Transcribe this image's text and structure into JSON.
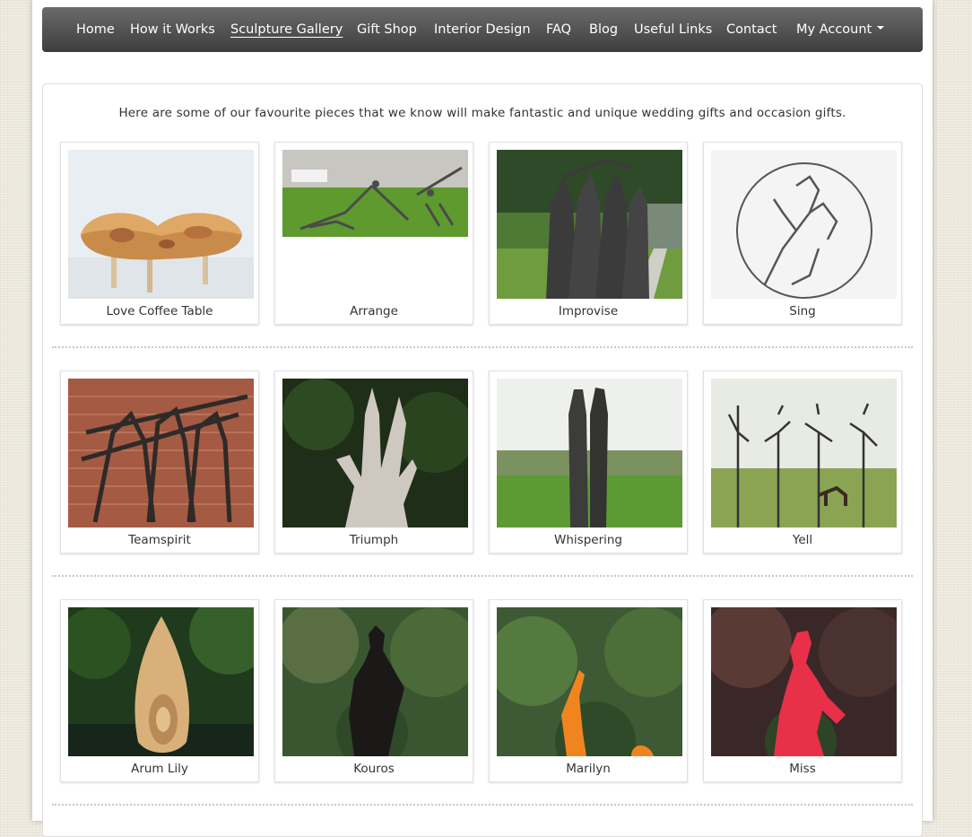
{
  "nav": {
    "items": [
      "Home",
      "How it Works",
      "Sculpture Gallery",
      "Gift Shop",
      "Interior Design",
      "FAQ",
      "Blog",
      "Useful Links",
      "Contact"
    ],
    "account": "My Account"
  },
  "intro": "Here are some of our favourite pieces that we know will make fantastic and unique wedding gifts and occasion gifts.",
  "rows": [
    [
      "Love Coffee Table",
      "Arrange",
      "Improvise",
      "Sing"
    ],
    [
      "Teamspirit",
      "Triumph",
      "Whispering",
      "Yell"
    ],
    [
      "Arum Lily",
      "Kouros",
      "Marilyn",
      "Miss"
    ]
  ]
}
